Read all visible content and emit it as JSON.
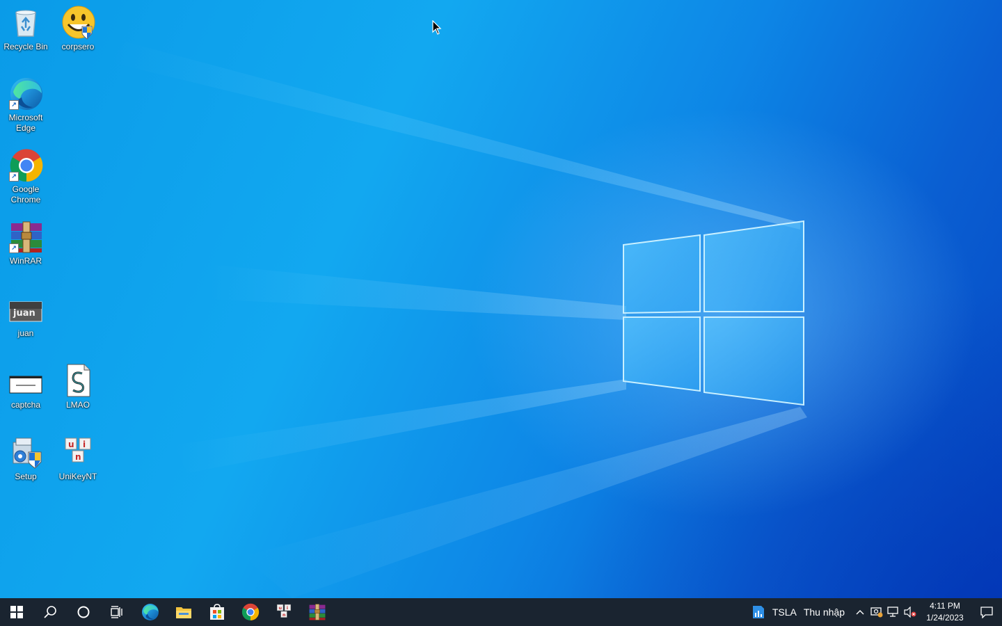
{
  "desktop": {
    "icons": [
      {
        "label": "Recycle Bin",
        "icon": "recycle-bin-icon"
      },
      {
        "label": "corpsero",
        "icon": "smiley-icon"
      },
      {
        "label": "Microsoft Edge",
        "icon": "edge-icon"
      },
      {
        "label": "Google Chrome",
        "icon": "chrome-icon"
      },
      {
        "label": "WinRAR",
        "icon": "winrar-icon"
      },
      {
        "label": "juan",
        "icon": "image-thumbnail-icon"
      },
      {
        "label": "captcha",
        "icon": "image-thumbnail-icon"
      },
      {
        "label": "LMAO",
        "icon": "script-file-icon"
      },
      {
        "label": "Setup",
        "icon": "setup-icon"
      },
      {
        "label": "UniKeyNT",
        "icon": "unikey-icon"
      }
    ],
    "thumbnails": {
      "juan_text": "juan"
    }
  },
  "taskbar": {
    "buttons": [
      {
        "name": "start",
        "icon": "windows-start-icon"
      },
      {
        "name": "search",
        "icon": "search-icon"
      },
      {
        "name": "cortana",
        "icon": "cortana-circle-icon"
      },
      {
        "name": "task-view",
        "icon": "task-view-icon"
      },
      {
        "name": "edge",
        "icon": "edge-icon"
      },
      {
        "name": "file-explorer",
        "icon": "folder-icon"
      },
      {
        "name": "store",
        "icon": "store-icon"
      },
      {
        "name": "chrome",
        "icon": "chrome-icon"
      },
      {
        "name": "unikey",
        "icon": "unikey-icon"
      },
      {
        "name": "winrar",
        "icon": "winrar-icon"
      }
    ],
    "tray": {
      "stock_ticker": "TSLA",
      "stock_label": "Thu nhập",
      "time": "4:11 PM",
      "date": "1/24/2023"
    }
  },
  "colors": {
    "taskbar_bg": "#1a2430",
    "accent": "#0078d7"
  }
}
